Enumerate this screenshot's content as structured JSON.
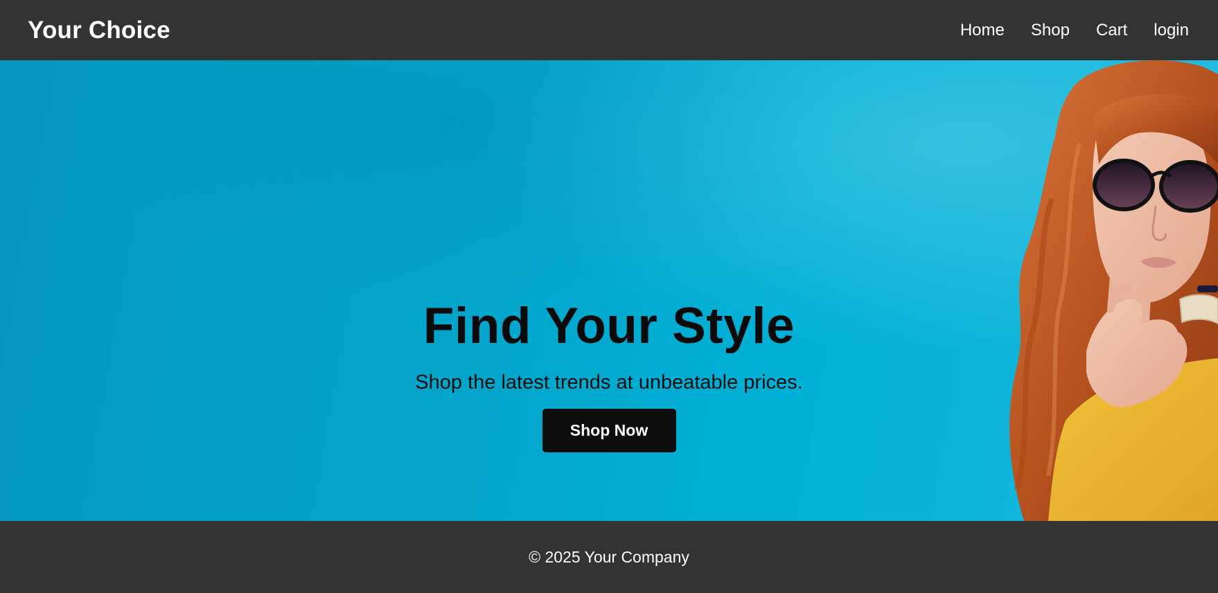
{
  "header": {
    "brand": "Your Choice",
    "nav": [
      {
        "label": "Home"
      },
      {
        "label": "Shop"
      },
      {
        "label": "Cart"
      },
      {
        "label": "login"
      }
    ]
  },
  "hero": {
    "title": "Find Your Style",
    "subtitle": "Shop the latest trends at unbeatable prices.",
    "cta_label": "Shop Now",
    "background_color": "#00b0d6",
    "image": "woman-with-sunglasses-photo"
  },
  "footer": {
    "copyright": "© 2025 Your Company"
  },
  "colors": {
    "nav_bg": "#333333",
    "button_bg": "#0d0d0d",
    "text_light": "#ffffff",
    "text_dark": "#0b0b0b"
  }
}
